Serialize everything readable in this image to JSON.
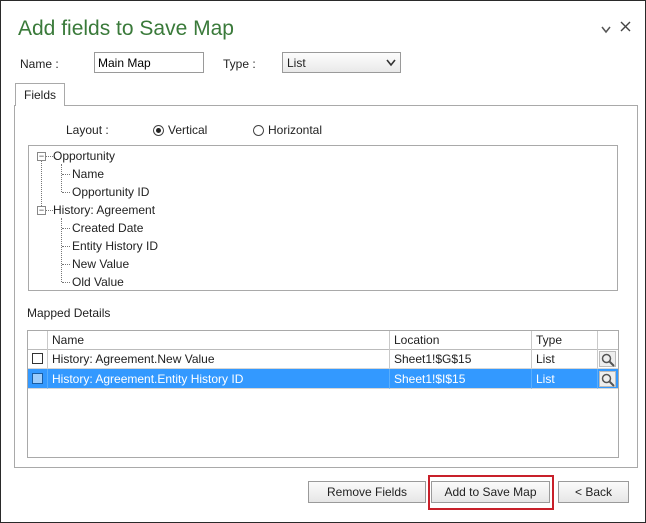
{
  "dialog": {
    "title": "Add fields to Save Map",
    "dropdown_icon": "chevron-down-icon",
    "close_icon": "close-icon"
  },
  "form": {
    "name_label": "Name :",
    "name_value": "Main Map",
    "type_label": "Type :",
    "type_value": "List"
  },
  "tabs": [
    {
      "label": "Fields"
    }
  ],
  "layout": {
    "label": "Layout :",
    "options": [
      {
        "label": "Vertical",
        "selected": true
      },
      {
        "label": "Horizontal",
        "selected": false
      }
    ]
  },
  "tree": {
    "groups": [
      {
        "label": "Opportunity",
        "children": [
          "Name",
          "Opportunity ID"
        ]
      },
      {
        "label": "History: Agreement",
        "children": [
          "Created Date",
          "Entity History ID",
          "New Value",
          "Old Value"
        ]
      }
    ]
  },
  "mapped": {
    "label": "Mapped Details",
    "columns": [
      "Name",
      "Location",
      "Type"
    ],
    "rows": [
      {
        "name": "History: Agreement.New Value",
        "location": "Sheet1!$G$15",
        "type": "List",
        "selected": false
      },
      {
        "name": "History: Agreement.Entity History ID",
        "location": "Sheet1!$I$15",
        "type": "List",
        "selected": true
      }
    ]
  },
  "buttons": {
    "remove": "Remove Fields",
    "add": "Add to Save Map",
    "back": "< Back"
  },
  "colors": {
    "title": "#3a7a3a",
    "selection": "#3399ff",
    "highlight": "#c8202a"
  }
}
